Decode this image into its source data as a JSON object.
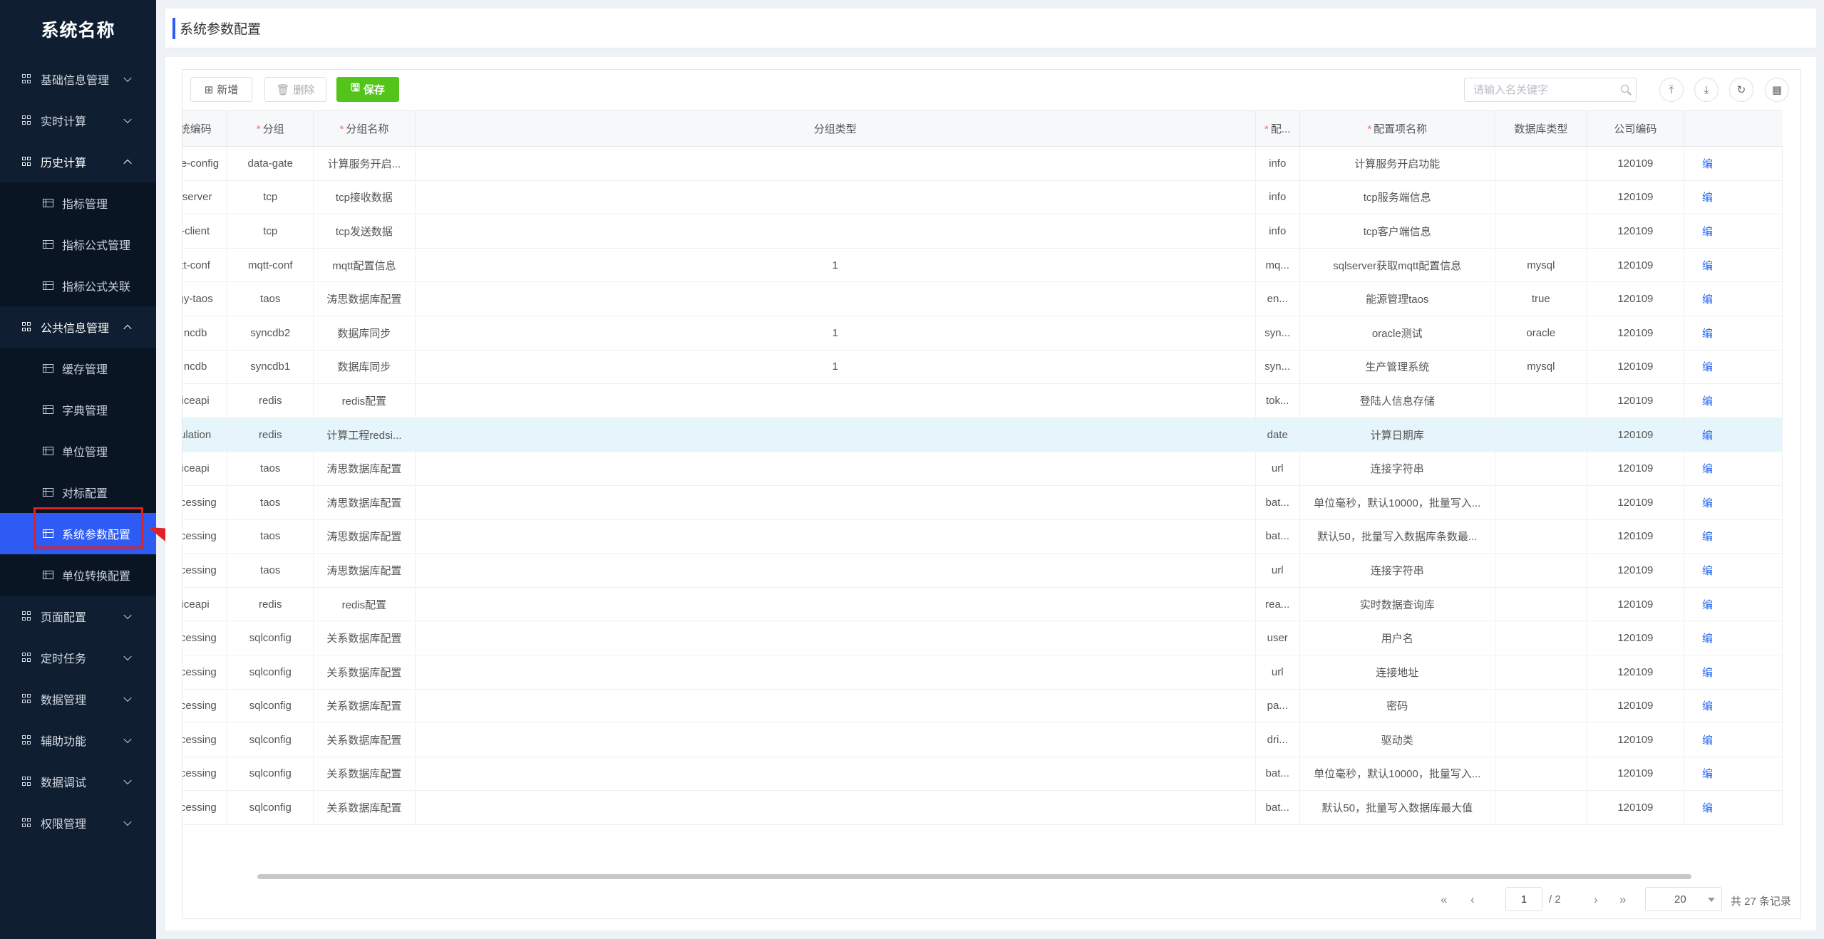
{
  "sidebar": {
    "brand": "系统名称",
    "menu": [
      {
        "label": "基础信息管理",
        "open": false
      },
      {
        "label": "实时计算",
        "open": false
      },
      {
        "label": "历史计算",
        "open": true,
        "children": [
          "指标管理",
          "指标公式管理",
          "指标公式关联"
        ]
      },
      {
        "label": "公共信息管理",
        "open": true,
        "children": [
          "缓存管理",
          "字典管理",
          "单位管理",
          "对标配置",
          "系统参数配置",
          "单位转换配置"
        ]
      },
      {
        "label": "页面配置",
        "open": false
      },
      {
        "label": "定时任务",
        "open": false
      },
      {
        "label": "数据管理",
        "open": false
      },
      {
        "label": "辅助功能",
        "open": false
      },
      {
        "label": "数据调试",
        "open": false
      },
      {
        "label": "权限管理",
        "open": false
      }
    ],
    "active_item": "系统参数配置"
  },
  "header": {
    "title": "系统参数配置"
  },
  "toolbar": {
    "add_label": "新增",
    "delete_label": "删除",
    "save_label": "保存",
    "search_placeholder": "请输入名关键字"
  },
  "table": {
    "columns": [
      "统编码",
      "分组",
      "分组名称",
      "分组类型",
      "配...",
      "配置项名称",
      "数据库类型",
      "公司编码",
      "编"
    ],
    "required_columns": [
      1,
      2,
      4,
      5
    ],
    "rows": [
      [
        "ate-config",
        "data-gate",
        "计算服务开启...",
        "",
        "info",
        "计算服务开启功能",
        "",
        "120109",
        "编"
      ],
      [
        "-server",
        "tcp",
        "tcp接收数据",
        "",
        "info",
        "tcp服务端信息",
        "",
        "120109",
        "编"
      ],
      [
        "-client",
        "tcp",
        "tcp发送数据",
        "",
        "info",
        "tcp客户端信息",
        "",
        "120109",
        "编"
      ],
      [
        "tt-conf",
        "mqtt-conf",
        "mqtt配置信息",
        "1",
        "mq...",
        "sqlserver获取mqtt配置信息",
        "mysql",
        "120109",
        "编"
      ],
      [
        "gy-taos",
        "taos",
        "涛思数据库配置",
        "",
        "en...",
        "能源管理taos",
        "true",
        "120109",
        "编"
      ],
      [
        "ncdb",
        "syncdb2",
        "数据库同步",
        "1",
        "syn...",
        "oracle测试",
        "oracle",
        "120109",
        "编"
      ],
      [
        "ncdb",
        "syncdb1",
        "数据库同步",
        "1",
        "syn...",
        "生产管理系统",
        "mysql",
        "120109",
        "编"
      ],
      [
        "iceapi",
        "redis",
        "redis配置",
        "",
        "tok...",
        "登陆人信息存储",
        "",
        "120109",
        "编"
      ],
      [
        "ulation",
        "redis",
        "计算工程redsi...",
        "",
        "date",
        "计算日期库",
        "",
        "120109",
        "编"
      ],
      [
        "iceapi",
        "taos",
        "涛思数据库配置",
        "",
        "url",
        "连接字符串",
        "",
        "120109",
        "编"
      ],
      [
        "ocessing",
        "taos",
        "涛思数据库配置",
        "",
        "bat...",
        "单位毫秒，默认10000，批量写入...",
        "",
        "120109",
        "编"
      ],
      [
        "ocessing",
        "taos",
        "涛思数据库配置",
        "",
        "bat...",
        "默认50，批量写入数据库条数最...",
        "",
        "120109",
        "编"
      ],
      [
        "ocessing",
        "taos",
        "涛思数据库配置",
        "",
        "url",
        "连接字符串",
        "",
        "120109",
        "编"
      ],
      [
        "iceapi",
        "redis",
        "redis配置",
        "",
        "rea...",
        "实时数据查询库",
        "",
        "120109",
        "编"
      ],
      [
        "ocessing",
        "sqlconfig",
        "关系数据库配置",
        "",
        "user",
        "用户名",
        "",
        "120109",
        "编"
      ],
      [
        "ocessing",
        "sqlconfig",
        "关系数据库配置",
        "",
        "url",
        "连接地址",
        "",
        "120109",
        "编"
      ],
      [
        "ocessing",
        "sqlconfig",
        "关系数据库配置",
        "",
        "pa...",
        "密码",
        "",
        "120109",
        "编"
      ],
      [
        "ocessing",
        "sqlconfig",
        "关系数据库配置",
        "",
        "dri...",
        "驱动类",
        "",
        "120109",
        "编"
      ],
      [
        "ocessing",
        "sqlconfig",
        "关系数据库配置",
        "",
        "bat...",
        "单位毫秒，默认10000，批量写入...",
        "",
        "120109",
        "编"
      ],
      [
        "ocessing",
        "sqlconfig",
        "关系数据库配置",
        "",
        "bat...",
        "默认50，批量写入数据库最大值",
        "",
        "120109",
        "编"
      ]
    ],
    "highlighted_row": 8
  },
  "pager": {
    "current_page": "1",
    "total_pages": "/ 2",
    "page_size": "20",
    "total_label": "共 27 条记录"
  },
  "colors": {
    "accent": "#2d5bf3",
    "sidebar_bg": "#0f1e30",
    "save_green": "#52c41a",
    "annotation_red": "#e02222"
  }
}
